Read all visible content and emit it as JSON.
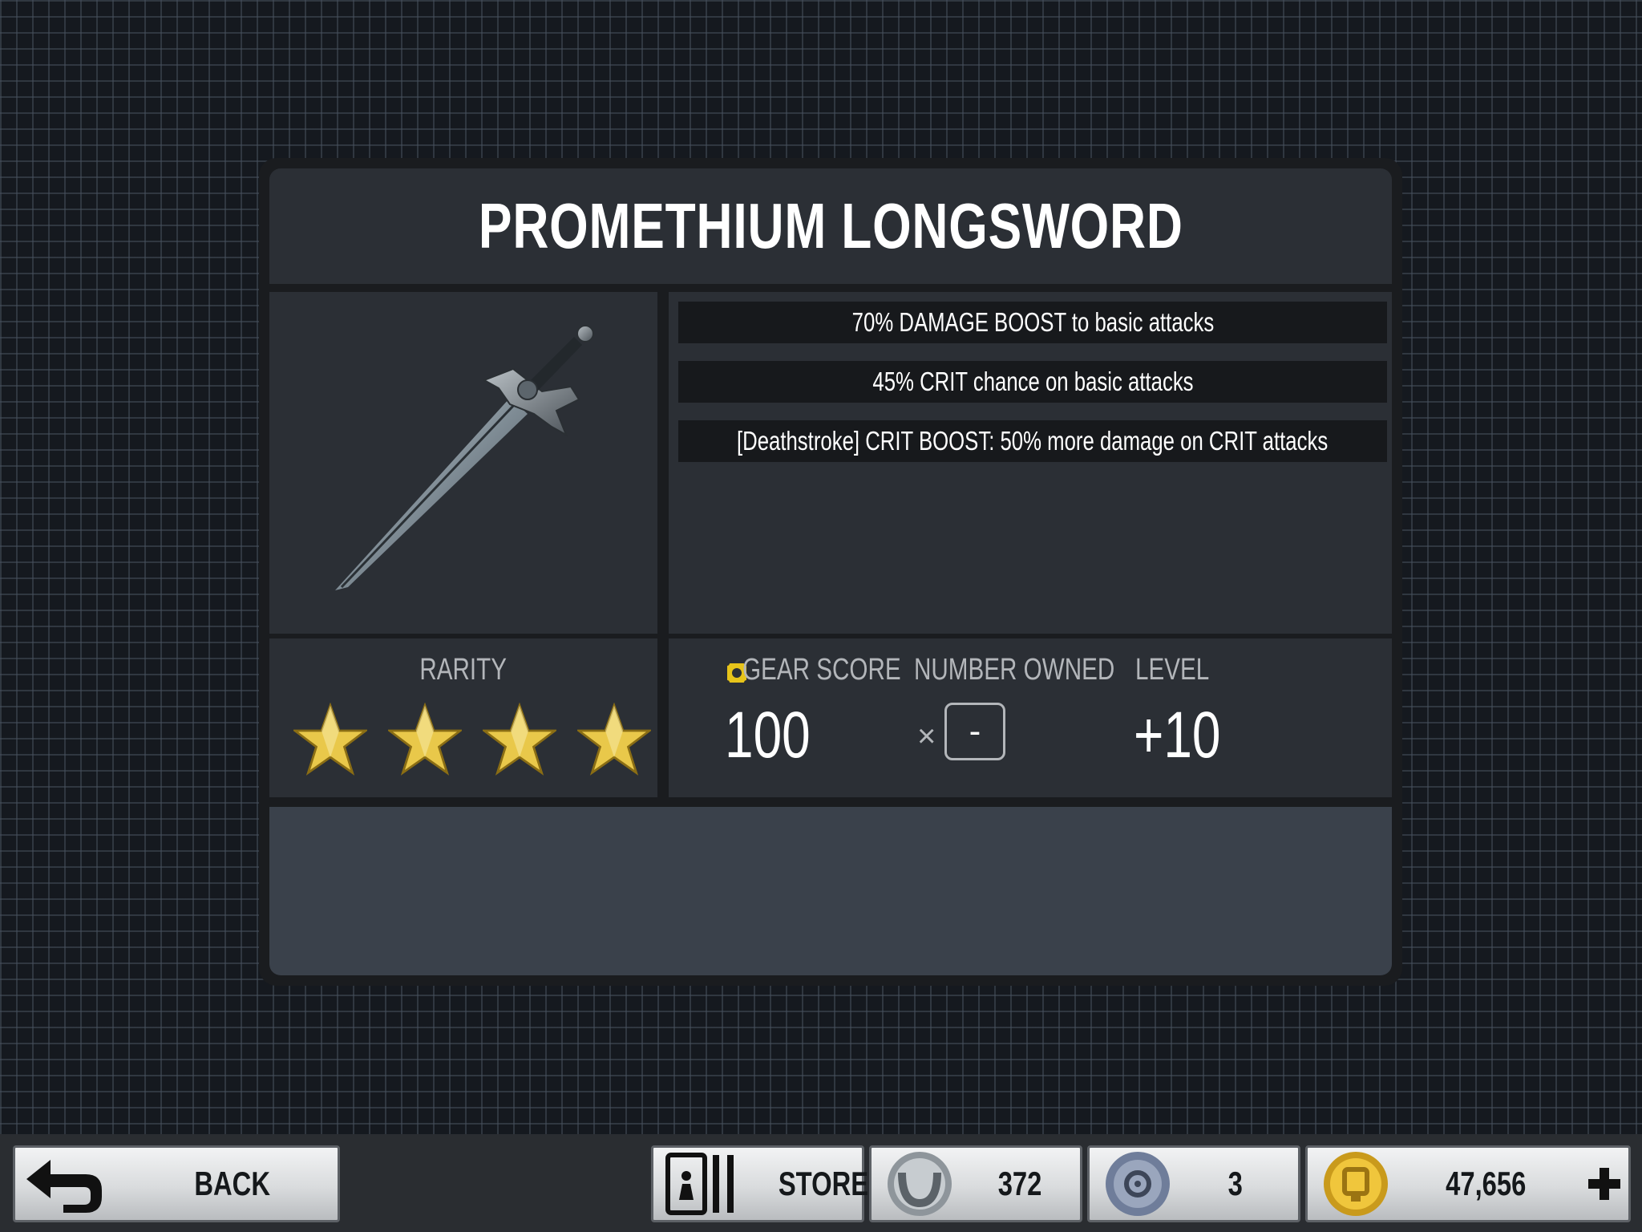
{
  "item": {
    "name": "PROMETHIUM LONGSWORD",
    "effects": [
      "70% DAMAGE BOOST to basic attacks",
      "45% CRIT chance on basic attacks",
      "[Deathstroke] CRIT BOOST: 50% more damage on CRIT attacks"
    ],
    "rarity_label": "RARITY",
    "rarity_stars": 4,
    "gear_score_label": "GEAR SCORE",
    "gear_score": "100",
    "number_owned_label": "NUMBER OWNED",
    "number_owned_prefix": "×",
    "number_owned": "-",
    "level_label": "LEVEL",
    "level": "+10",
    "description": ""
  },
  "bottom_bar": {
    "back_label": "BACK",
    "store_label": "STORE",
    "power_credits": "372",
    "alliance_credits": "3",
    "coins": "47,656"
  },
  "colors": {
    "star_gold": "#e9c84a",
    "gear_score_icon": "#e7c41a",
    "panel_bg": "#2b2f35",
    "description_bg": "#3a414b"
  },
  "icons": [
    "sword-image",
    "star-icon",
    "gear-score-icon",
    "back-arrow-icon",
    "store-card-icon",
    "power-credits-icon",
    "alliance-credits-icon",
    "coin-icon",
    "plus-icon"
  ]
}
